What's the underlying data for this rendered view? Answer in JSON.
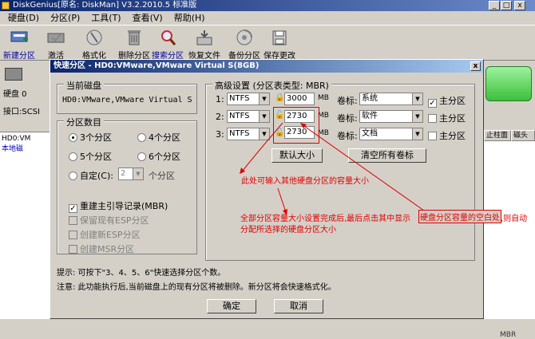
{
  "app": {
    "title": "DiskGenius [原名: DiskMan] V3.2.2010.5 标准版",
    "title_visible": "DiskGenius[原名: DiskMan] V3.2.2010.5 标准版",
    "min_btn": "_",
    "max_btn": "□",
    "close_btn": "x"
  },
  "menu": [
    "硬盘(D)",
    "分区(P)",
    "工具(T)",
    "查看(V)",
    "帮助(H)"
  ],
  "toolbar": [
    {
      "label": "新建分区",
      "icon": "new-partition-icon"
    },
    {
      "label": "激活",
      "icon": "activate-icon"
    },
    {
      "label": "格式化",
      "icon": "format-icon"
    },
    {
      "label": "删除分区",
      "icon": "delete-partition-icon"
    },
    {
      "label": "搜索分区",
      "icon": "search-partition-icon"
    },
    {
      "label": "恢复文件",
      "icon": "recover-file-icon"
    },
    {
      "label": "备份分区",
      "icon": "backup-partition-icon"
    },
    {
      "label": "保存更改",
      "icon": "save-changes-icon"
    }
  ],
  "left": {
    "disk_label": "硬盘 0",
    "interface": "接口:SCSI",
    "tree": [
      "HD0:VM",
      "本地磁"
    ]
  },
  "right": {
    "col1": "止柱面",
    "col2": "磁头",
    "mbr": "MBR"
  },
  "dialog": {
    "title": "快速分区 - HD0:VMware,VMware Virtual S(8GB)",
    "close": "x",
    "current_disk_legend": "当前磁盘",
    "current_disk_value": "HD0:VMware,VMware Virtual S",
    "count_legend": "分区数目",
    "counts": [
      {
        "label": "3个分区",
        "checked": true
      },
      {
        "label": "4个分区",
        "checked": false
      },
      {
        "label": "5个分区",
        "checked": false
      },
      {
        "label": "6个分区",
        "checked": false
      }
    ],
    "custom_label": "自定(C):",
    "custom_value": "2",
    "custom_suffix": "个分区",
    "rebuild_mbr": "重建主引导记录(MBR)",
    "keep_esp": "保留现有ESP分区",
    "create_esp": "创建新ESP分区",
    "create_msr": "创建MSR分区",
    "adv_legend": "高级设置 (分区表类型: MBR)",
    "rows": [
      {
        "idx": "1:",
        "fs": "NTFS",
        "size": "3000",
        "unit": "MB",
        "vol_label": "卷标:",
        "vol": "系统",
        "primary": "主分区",
        "is_primary": true
      },
      {
        "idx": "2:",
        "fs": "NTFS",
        "size": "2730",
        "unit": "MB",
        "vol_label": "卷标:",
        "vol": "软件",
        "primary": "主分区",
        "is_primary": false
      },
      {
        "idx": "3:",
        "fs": "NTFS",
        "size": "2730",
        "unit": "MB",
        "vol_label": "卷标:",
        "vol": "文档",
        "primary": "主分区",
        "is_primary": false
      }
    ],
    "default_size_btn": "默认大小",
    "clear_labels_btn": "清空所有卷标",
    "hint": "提示: 可按下\"3、4、5、6\"快速选择分区个数。",
    "warning": "注意: 此功能执行后,当前磁盘上的现有分区将被删除。新分区将会快速格式化。",
    "ok": "确定",
    "cancel": "取消"
  },
  "annotations": {
    "note1": "此处可输入其他硬盘分区的容量大小",
    "note2_line1_a": "全部分区容量大小设置完成后,最后点击其中显示",
    "note2_line1_box": "硬盘分区容量的空白处",
    "note2_line1_b": ",则自动",
    "note2_line2": "分配所选择的硬盘分区大小",
    "color": "#e00000"
  }
}
